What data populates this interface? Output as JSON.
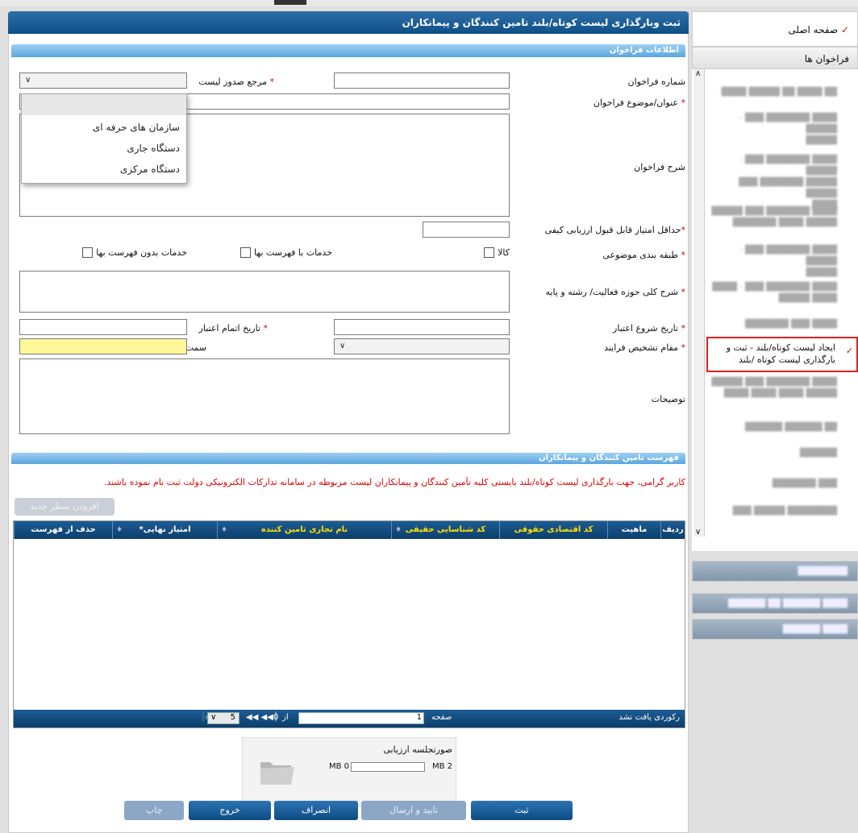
{
  "page_title": "ثبت وبارگذاری لیست کوتاه/بلند تامین کنندگان و پیمانکاران",
  "section_info": "اطلاعات فراخوان",
  "form": {
    "call_number_label": "شماره فراخوان",
    "list_issuer_label": "مرجع صدور لیست",
    "call_subject_label": "عنوان/موضوع فراخوان",
    "call_description_label": "شرح فراخوان",
    "min_score_label": "حداقل امتیاز قابل قبول ارزیابی کیفی",
    "category_label": "طبقه بندی موضوعی",
    "category_options": [
      "کالا",
      "خدمات با فهرست بها",
      "خدمات بدون فهرست بها"
    ],
    "activity_label": "شرح کلی حوزه فعالیت/ رشته و پایه",
    "validity_start_label": "تاریخ شروع اعتبار",
    "validity_end_label": "تاریخ اتمام اعتبار",
    "authority_label": "مقام تشخیص فرایند",
    "position_label": "سمت",
    "notes_label": "توضیحات",
    "required_mark": "*"
  },
  "dropdown": {
    "options": [
      "سازمان های حرفه ای",
      "دستگاه جاری",
      "دستگاه مرکزی"
    ]
  },
  "section_list": "فهرست تامین کنندگان و پیمانکاران",
  "warning": "کاربر گرامی، جهت بارگذاری لیست کوتاه/بلند بایستی کلیه تأمین کنندگان و پیمانکاران لیست مربوطه در سامانه تدارکات الکترونیکی دولت ثبت نام نموده باشند.",
  "add_row_button": "افزودن سطر جدید",
  "grid": {
    "columns": [
      "ردیف",
      "ماهیت",
      "کد اقتصادی حقوقی",
      "کد شناسایی حقیقی",
      "نام تجاری تامین کننده",
      "*امتیاز نهایی",
      "حذف از فهرست"
    ],
    "no_records": "رکوردی یافت نشد",
    "page_label": "صفحه",
    "page_value": "1",
    "of_label": "از",
    "of_value": "0",
    "page_size": "5"
  },
  "upload": {
    "title": "صورتجلسه ارزیابی",
    "used": "0 MB",
    "max": "2 MB",
    "progress": 0
  },
  "buttons": {
    "submit": "ثبت",
    "confirm_send": "تایید و ارسال",
    "cancel": "انصراف",
    "exit": "خروج",
    "print": "چاپ"
  },
  "sidebar": {
    "home": "صفحه اصلی",
    "calls": "فراخوان ها",
    "active_item": "ایجاد لیست کوتاه/بلند - ثبت و بارگذاری لیست کوتاه /بلند"
  },
  "colors": {
    "header_dark": "#0e4f86",
    "section_light": "#5ba6de",
    "warning": "#e00000",
    "highlight_input": "#fff79a",
    "active_border": "#e02020"
  }
}
